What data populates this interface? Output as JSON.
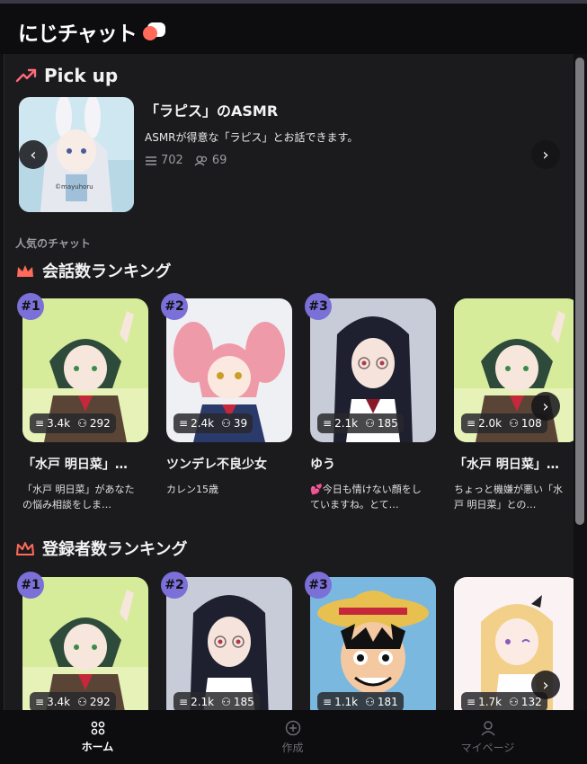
{
  "app": {
    "name": "にじチャット"
  },
  "pickup": {
    "title": "Pick up",
    "name": "「ラピス」のASMR",
    "desc": "ASMRが得意な「ラピス」とお話できます。",
    "messages": "702",
    "users": "69",
    "watermark": "©mayuhoru"
  },
  "popular_label": "人気のチャット",
  "ranking1": {
    "title": "会話数ランキング",
    "cards": [
      {
        "rank": "#1",
        "messages": "3.4k",
        "users": "292",
        "name": "「水戸 明日菜」のお悩み相談",
        "desc": "「水戸 明日菜」があなたの悩み相談をしま…"
      },
      {
        "rank": "#2",
        "messages": "2.4k",
        "users": "39",
        "name": "ツンデレ不良少女",
        "desc": "カレン15歳"
      },
      {
        "rank": "#3",
        "messages": "2.1k",
        "users": "185",
        "name": "ゆう",
        "desc": "💕今日も情けない顔をしていますね。とて…"
      },
      {
        "rank": "",
        "messages": "2.0k",
        "users": "108",
        "name": "「水戸 明日菜」ちょっと機嫌",
        "desc": "ちょっと機嫌が悪い「水戸 明日菜」との…"
      }
    ]
  },
  "ranking2": {
    "title": "登録者数ランキング",
    "cards": [
      {
        "rank": "#1",
        "messages": "3.4k",
        "users": "292"
      },
      {
        "rank": "#2",
        "messages": "2.1k",
        "users": "185"
      },
      {
        "rank": "#3",
        "messages": "1.1k",
        "users": "181"
      },
      {
        "rank": "",
        "messages": "1.7k",
        "users": "132"
      }
    ]
  },
  "tabs": [
    {
      "label": "ホーム",
      "icon": "home-icon"
    },
    {
      "label": "作成",
      "icon": "plus-circle-icon"
    },
    {
      "label": "マイページ",
      "icon": "person-icon"
    }
  ],
  "colors": {
    "accent": "#ff6a5a",
    "badge": "#7b6fd8",
    "bg": "#1b1b1e"
  }
}
